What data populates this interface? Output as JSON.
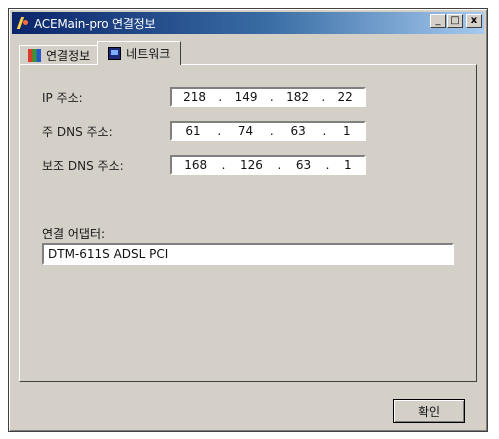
{
  "window": {
    "title": "ACEMain-pro 연결정보",
    "controls": {
      "minimize": "_",
      "maximize": "□",
      "close": "x"
    }
  },
  "tabs": [
    {
      "label": "연결정보",
      "icon": "connection-info-icon",
      "active": false
    },
    {
      "label": "네트워크",
      "icon": "network-icon",
      "active": true
    }
  ],
  "network": {
    "ip": {
      "label": "IP 주소:",
      "octets": [
        "218",
        "149",
        "182",
        "22"
      ]
    },
    "primary_dns": {
      "label": "주 DNS 주소:",
      "octets": [
        "61",
        "74",
        "63",
        "1"
      ]
    },
    "secondary_dns": {
      "label": "보조 DNS 주소:",
      "octets": [
        "168",
        "126",
        "63",
        "1"
      ]
    },
    "adapter": {
      "label": "연결 어댑터:",
      "value": "DTM-611S ADSL PCI"
    }
  },
  "buttons": {
    "ok": "확인"
  }
}
